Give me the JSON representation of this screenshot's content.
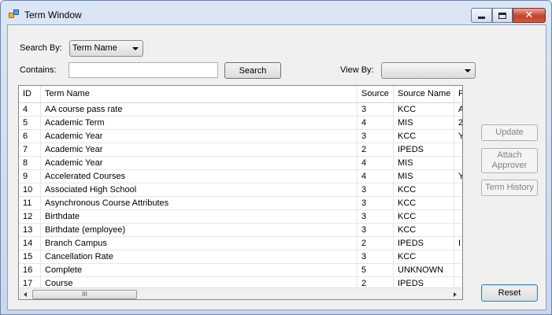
{
  "window": {
    "title": "Term Window"
  },
  "search": {
    "search_by_label": "Search By:",
    "search_by_value": "Term Name",
    "contains_label": "Contains:",
    "contains_value": "",
    "search_button": "Search",
    "view_by_label": "View By:",
    "view_by_value": ""
  },
  "grid": {
    "columns": [
      "ID",
      "Term Name",
      "Source",
      "Source Name",
      "F"
    ],
    "rows": [
      [
        "4",
        "AA course pass rate",
        "3",
        "KCC",
        "A"
      ],
      [
        "5",
        "Academic Term",
        "4",
        "MIS",
        "2"
      ],
      [
        "6",
        "Academic Year",
        "3",
        "KCC",
        "Y"
      ],
      [
        "7",
        "Academic Year",
        "2",
        "IPEDS",
        ""
      ],
      [
        "8",
        "Academic Year",
        "4",
        "MIS",
        ""
      ],
      [
        "9",
        "Accelerated Courses",
        "4",
        "MIS",
        "Y"
      ],
      [
        "10",
        "Associated High School",
        "3",
        "KCC",
        ""
      ],
      [
        "11",
        "Asynchronous Course Attributes",
        "3",
        "KCC",
        ""
      ],
      [
        "12",
        "Birthdate",
        "3",
        "KCC",
        ""
      ],
      [
        "13",
        "Birthdate (employee)",
        "3",
        "KCC",
        ""
      ],
      [
        "14",
        "Branch Campus",
        "2",
        "IPEDS",
        "I"
      ],
      [
        "15",
        "Cancellation Rate",
        "3",
        "KCC",
        ""
      ],
      [
        "16",
        "Complete",
        "5",
        "UNKNOWN",
        ""
      ],
      [
        "17",
        "Course",
        "2",
        "IPEDS",
        ""
      ]
    ],
    "hscroll_grip": "III",
    "vscroll_grip": "≡"
  },
  "actions": {
    "update": "Update",
    "attach_approver": "Attach Approver",
    "term_history": "Term History",
    "reset": "Reset"
  }
}
